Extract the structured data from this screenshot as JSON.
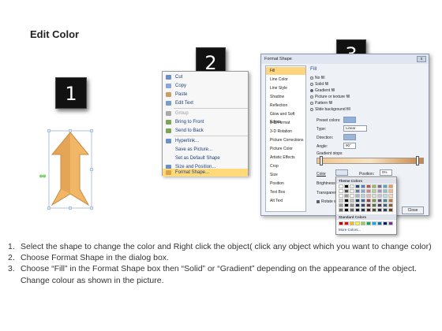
{
  "title": "Edit Color",
  "badges": [
    "1",
    "2",
    "3"
  ],
  "arrow": {
    "fill": "#f2b766",
    "fill_dark": "#c98a3d",
    "handle_color": "#7cd36b"
  },
  "context_menu": {
    "items": [
      {
        "label": "Cut",
        "icon": "scissors-icon",
        "dim": false
      },
      {
        "label": "Copy",
        "icon": "copy-icon",
        "dim": false
      },
      {
        "label": "Paste",
        "icon": "paste-icon",
        "dim": false
      },
      {
        "label": "Edit Text",
        "icon": "edit-text-icon",
        "dim": false
      },
      {
        "label": "Group",
        "icon": "group-icon",
        "dim": true
      },
      {
        "label": "Bring to Front",
        "icon": "bring-front-icon",
        "dim": false
      },
      {
        "label": "Send to Back",
        "icon": "send-back-icon",
        "dim": false
      },
      {
        "label": "Hyperlink...",
        "icon": "hyperlink-icon",
        "dim": false
      },
      {
        "label": "Save as Picture...",
        "icon": "",
        "dim": false
      },
      {
        "label": "Set as Default Shape",
        "icon": "",
        "dim": false
      },
      {
        "label": "Size and Position...",
        "icon": "size-icon",
        "dim": false
      },
      {
        "label": "Format Shape...",
        "icon": "format-icon",
        "dim": false
      }
    ]
  },
  "dialog": {
    "title": "Format Shape",
    "close": "x",
    "nav": [
      "Fill",
      "Line Color",
      "Line Style",
      "Shadow",
      "Reflection",
      "Glow and Soft Edges",
      "3-D Format",
      "3-D Rotation",
      "Picture Corrections",
      "Picture Color",
      "Artistic Effects",
      "Crop",
      "Size",
      "Position",
      "Text Box",
      "Alt Text"
    ],
    "pane_title": "Fill",
    "options": [
      "No fill",
      "Solid fill",
      "Gradient fill",
      "Picture or texture fill",
      "Pattern fill",
      "Slide background fill"
    ],
    "selected_option": "Gradient fill",
    "fields": {
      "preset_colors": "Preset colors:",
      "type": "Type:",
      "type_value": "Linear",
      "direction": "Direction:",
      "angle": "Angle:",
      "angle_value": "90°",
      "gradient_stops": "Gradient stops",
      "color": "Color",
      "position": "Position:",
      "position_value": "0%",
      "brightness": "Brightness",
      "transparency": "Transparency",
      "rotate": "Rotate with shape"
    },
    "close_button": "Close"
  },
  "palette": {
    "theme_header": "Theme Colors",
    "standard_header": "Standard Colors",
    "more": "More Colors...",
    "theme_top": [
      "#ffffff",
      "#000000",
      "#eeece1",
      "#1f497d",
      "#4f81bd",
      "#c0504d",
      "#9bbb59",
      "#8064a2",
      "#4bacc6",
      "#f79646"
    ],
    "standard": [
      "#c00000",
      "#ff0000",
      "#ffc000",
      "#ffff00",
      "#92d050",
      "#00b050",
      "#00b0f0",
      "#0070c0",
      "#002060",
      "#7030a0"
    ]
  },
  "instructions": [
    {
      "n": "1.",
      "text": "Select the shape to change the color and Right click the object( click any object which you want to change color)"
    },
    {
      "n": "2.",
      "text": "Choose Format Shape in the dialog box."
    },
    {
      "n": "3.",
      "text": "Choose “Fill” in the Format Shape box then “Solid” or “Gradient” depending on the appearance of the object. Change colour as shown in the picture."
    }
  ]
}
